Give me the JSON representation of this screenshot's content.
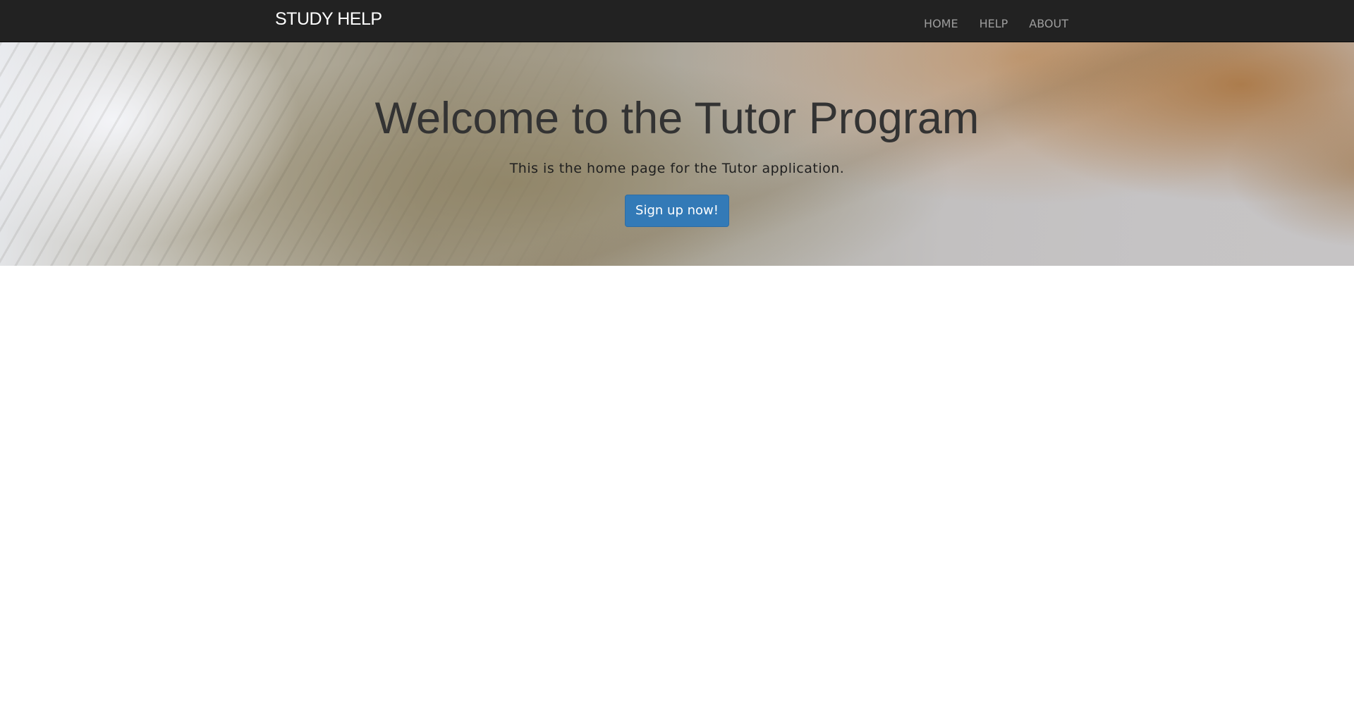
{
  "navbar": {
    "brand": "STUDY HELP",
    "links": [
      {
        "label": "HOME"
      },
      {
        "label": "HELP"
      },
      {
        "label": "ABOUT"
      }
    ]
  },
  "hero": {
    "title": "Welcome to the Tutor Program",
    "subtitle": "This is the home page for the Tutor application.",
    "cta_label": "Sign up now!"
  },
  "colors": {
    "navbar_background": "#222222",
    "brand_text": "#ffffff",
    "nav_link_text": "#9d9d9d",
    "hero_title_text": "#333333",
    "button_background": "#337ab7",
    "button_text": "#ffffff",
    "page_background": "#ffffff"
  }
}
